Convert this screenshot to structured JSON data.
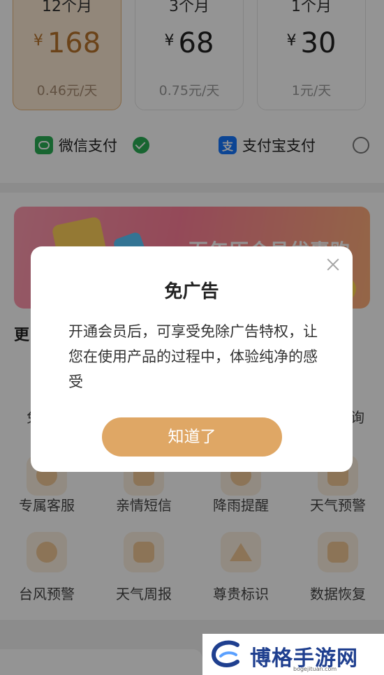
{
  "plans": [
    {
      "term": "12个月",
      "currency": "¥",
      "price": "168",
      "per_day": "0.46元/天",
      "selected": true
    },
    {
      "term": "3个月",
      "currency": "¥",
      "price": "68",
      "per_day": "0.75元/天",
      "selected": false
    },
    {
      "term": "1个月",
      "currency": "¥",
      "price": "30",
      "per_day": "1元/天",
      "selected": false
    }
  ],
  "payment": {
    "wechat_label": "微信支付",
    "alipay_label": "支付宝支付",
    "alipay_logo_char": "支"
  },
  "promo": {
    "title": "百年历会员优惠购"
  },
  "more_section": {
    "title_visible": "更"
  },
  "perks": {
    "row1_partial": [
      "免",
      "询"
    ],
    "row2": [
      "专属客服",
      "亲情短信",
      "降雨提醒",
      "天气预警"
    ],
    "row3": [
      "台风预警",
      "天气周报",
      "尊贵标识",
      "数据恢复"
    ]
  },
  "dialog": {
    "title": "免广告",
    "body": "开通会员后，可享受免除广告特权，让您在使用产品的过程中，体验纯净的感受",
    "confirm_label": "知道了"
  },
  "watermark": {
    "text": "博格手游网",
    "url": "bogejituan.com"
  },
  "colors": {
    "accent_gold": "#dfa765",
    "selected_card_bg": "#fbe9d3",
    "wechat_green": "#2aae55",
    "alipay_blue": "#1677ff"
  }
}
